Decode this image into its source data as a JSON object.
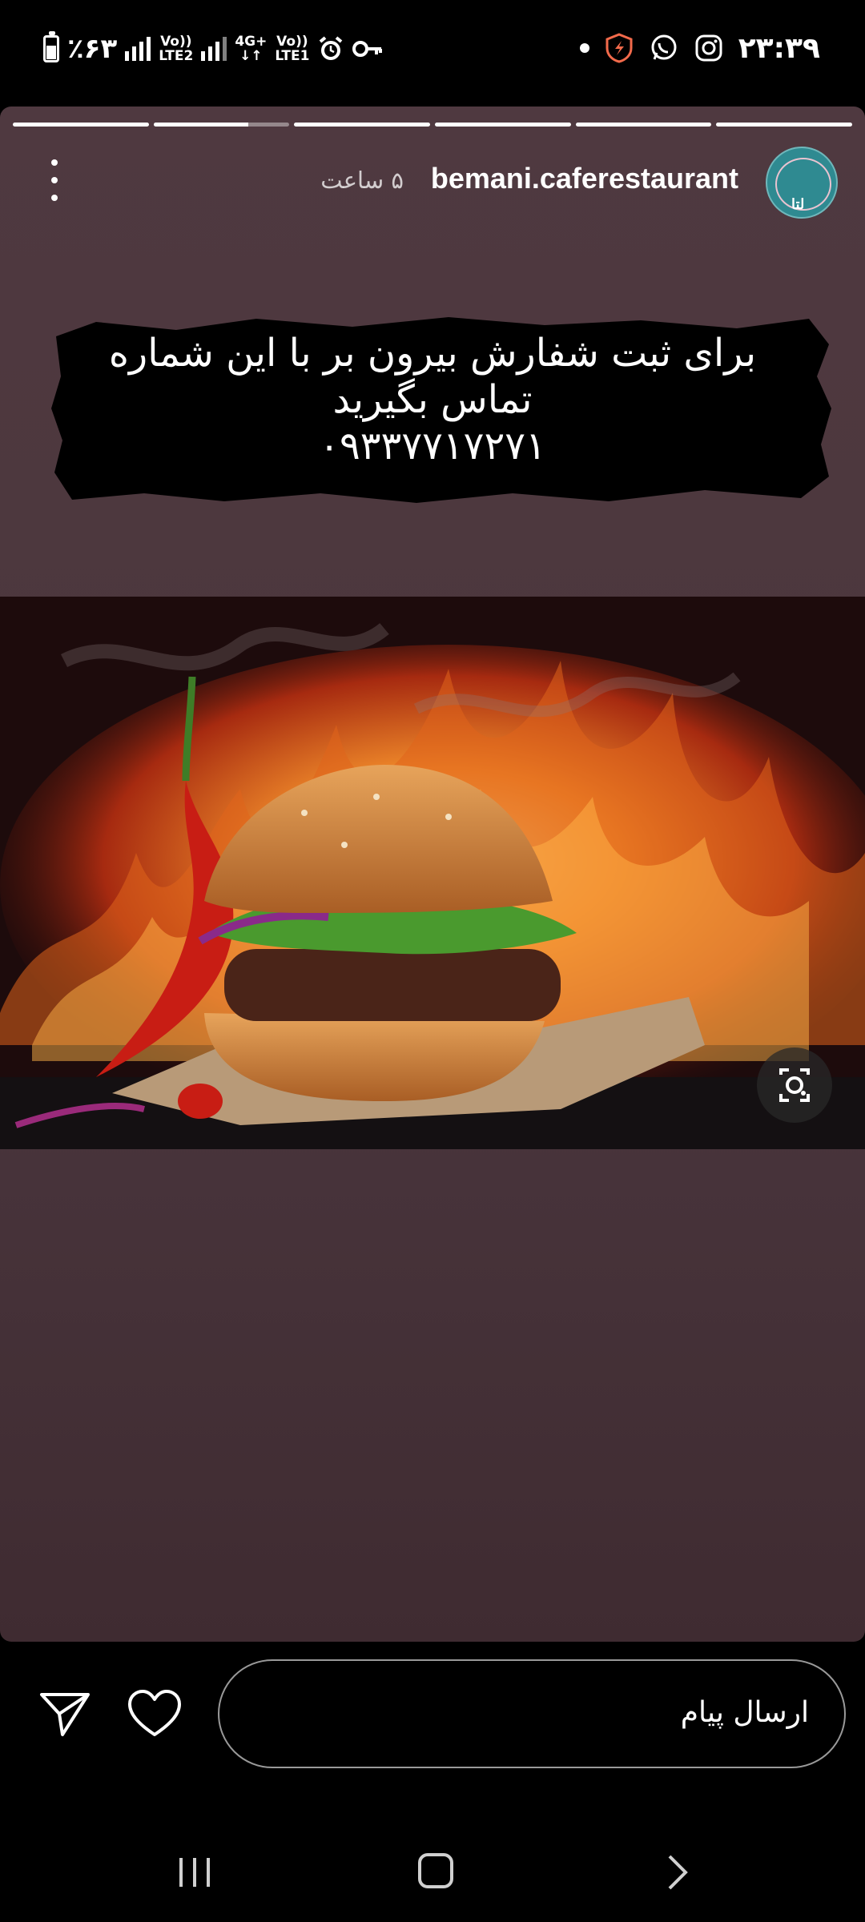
{
  "status_bar": {
    "battery_text": "٪۶۳",
    "network1_label": "Vo))\nLTE2",
    "network2_label": "4G+\nVo))\nLTE1",
    "clock": "۲۳:۳۹",
    "icons": [
      "battery-icon",
      "signal-icon",
      "alarm-icon",
      "vpn-key-icon",
      "notification-dot-icon",
      "security-shield-icon",
      "whatsapp-icon",
      "instagram-icon"
    ]
  },
  "story": {
    "progress_segments": [
      1,
      0.7,
      1,
      1,
      1,
      1
    ],
    "username": "bemani.caferestaurant",
    "time_ago": "۵ ساعت",
    "avatar_tag": "لتا",
    "caption_line1": "برای ثبت شفارش  بیرون بر با این شماره",
    "caption_line2": "تماس بگیرید",
    "caption_line3": "۰۹۳۳۷۷۱۷۲۷۱",
    "image_description_icon": "burger-flames-photo"
  },
  "bottom_bar": {
    "message_placeholder": "ارسال پیام"
  },
  "colors": {
    "story_bg": "#4c373d",
    "caption_brush": "#000000",
    "text": "#ffffff"
  }
}
